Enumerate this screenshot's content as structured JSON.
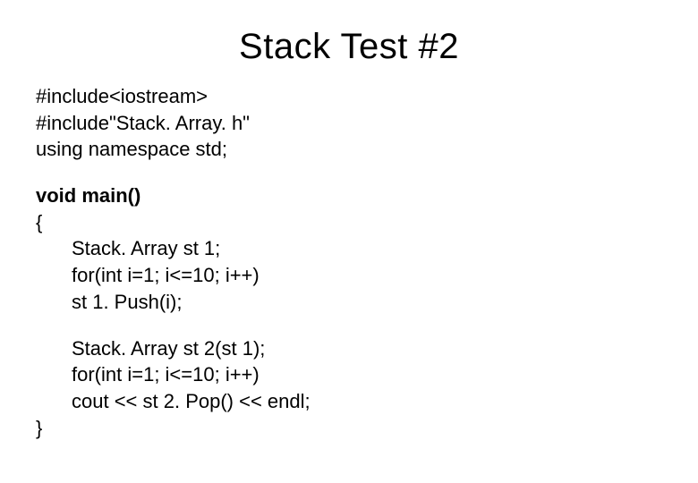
{
  "title": "Stack Test #2",
  "code": {
    "l1": "#include<iostream>",
    "l2": "#include\"Stack. Array. h\"",
    "l3": "using namespace std;",
    "l4": "void main()",
    "l5": "{",
    "l6": "Stack. Array st 1;",
    "l7": "for(int i=1; i<=10; i++)",
    "l8": "st 1. Push(i);",
    "l9": "Stack. Array st 2(st 1);",
    "l10": "for(int i=1; i<=10; i++)",
    "l11": "cout << st 2. Pop() << endl;",
    "l12": "}"
  }
}
